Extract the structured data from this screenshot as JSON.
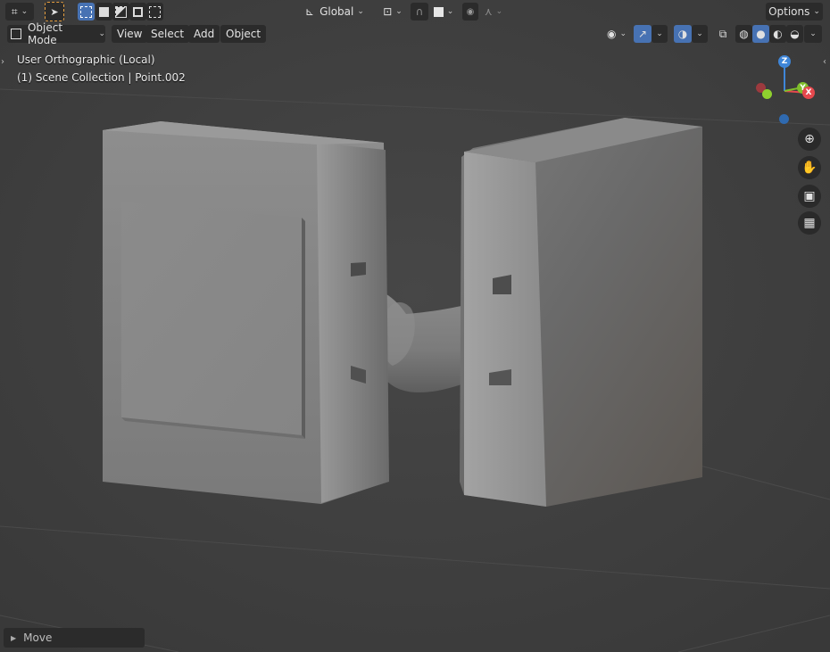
{
  "header": {
    "transform_orientation": "Global",
    "options_label": "Options"
  },
  "toolbar": {
    "mode_label": "Object Mode",
    "menus": [
      "View",
      "Select",
      "Add",
      "Object"
    ]
  },
  "viewport": {
    "view_name": "User Orthographic (Local)",
    "collection_info": "(1) Scene Collection | Point.002",
    "gizmo": {
      "z": "Z",
      "y": "Y",
      "x": "X",
      "x_color": "#e5484d",
      "y_color": "#7fbf2b",
      "z_color": "#3f86d8"
    }
  },
  "last_operator": {
    "label": "Move"
  },
  "colors": {
    "active": "#4772b3",
    "panel": "#2b2b2b",
    "bg": "#3e3e3e"
  }
}
